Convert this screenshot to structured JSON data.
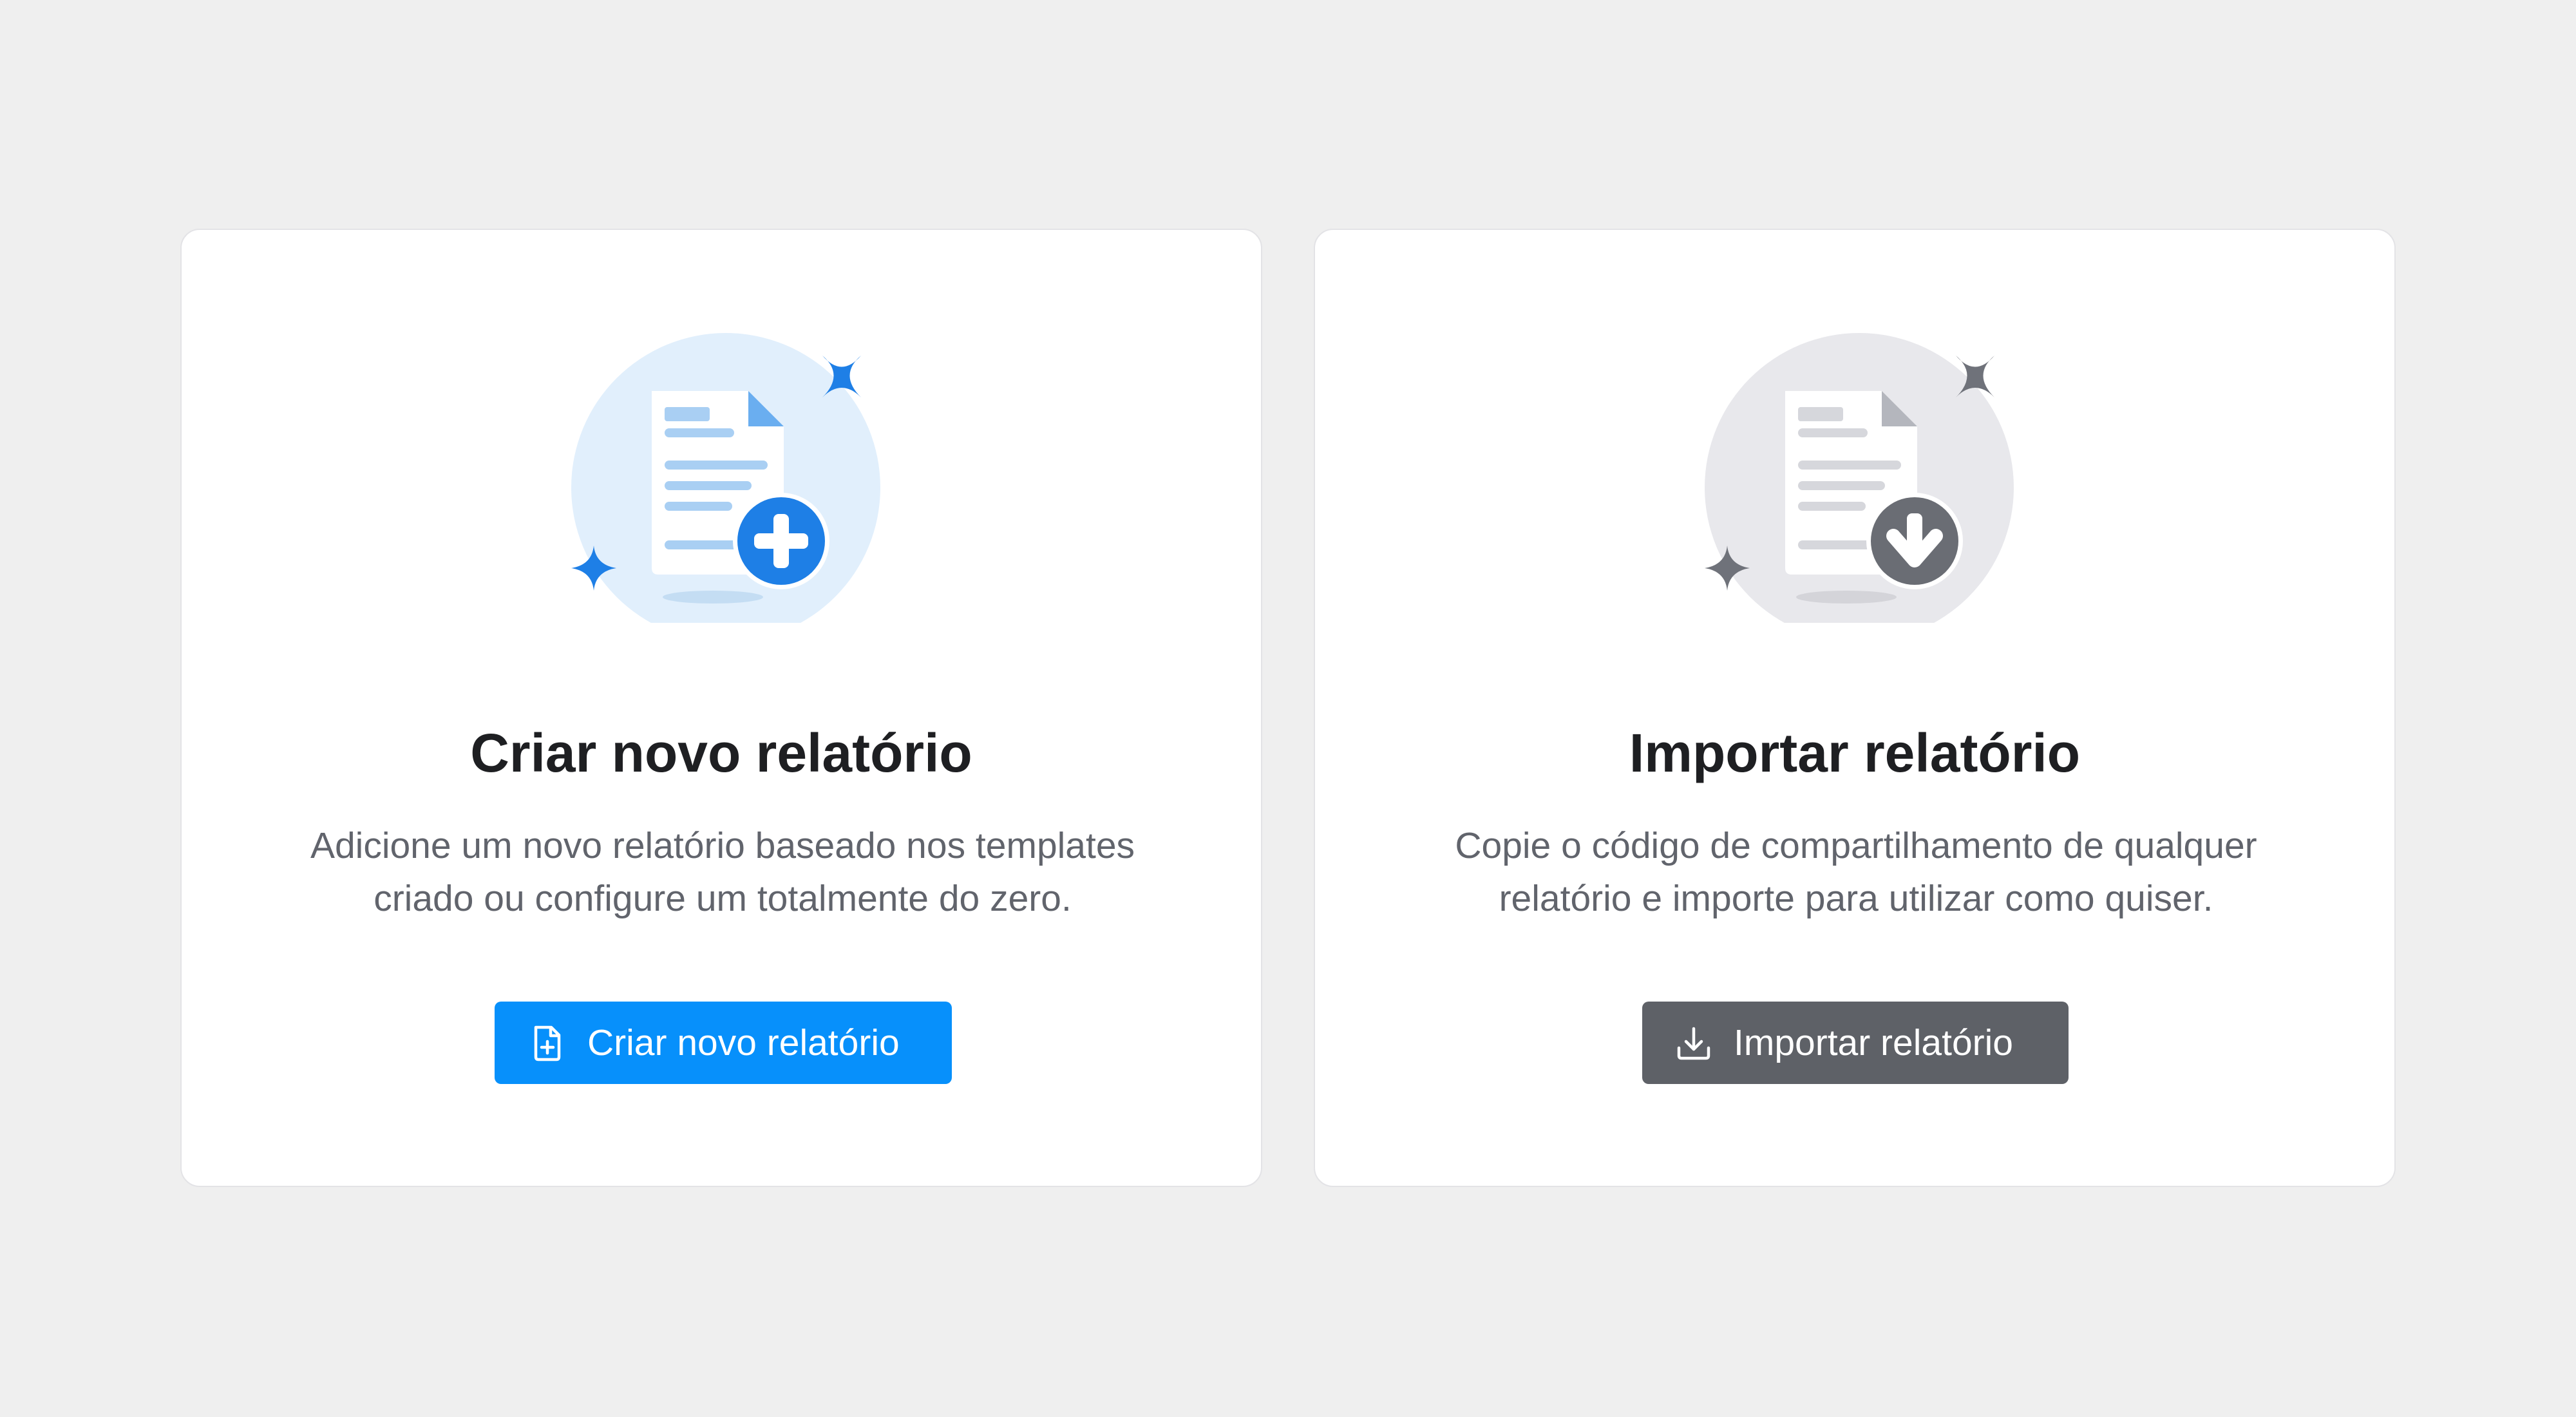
{
  "cards": [
    {
      "title": "Criar novo relatório",
      "description": "Adicione um novo relatório baseado nos templates criado ou configure um totalmente do zero.",
      "button_label": "Criar novo relatório",
      "button_icon": "file-plus-icon",
      "illustration_icon": "document-add-icon",
      "accent_color": "#0790fb"
    },
    {
      "title": "Importar relatório",
      "description": "Copie o código de compartilhamento de qualquer relatório e importe para utilizar como quiser.",
      "button_label": "Importar relatório",
      "button_icon": "download-icon",
      "illustration_icon": "document-download-icon",
      "accent_color": "#5e6167"
    }
  ],
  "colors": {
    "background": "#efefef",
    "card_background": "#ffffff",
    "primary_blue": "#0790fb",
    "neutral_gray": "#5e6167",
    "title_text": "#1e1f22",
    "body_text": "#61646c"
  }
}
